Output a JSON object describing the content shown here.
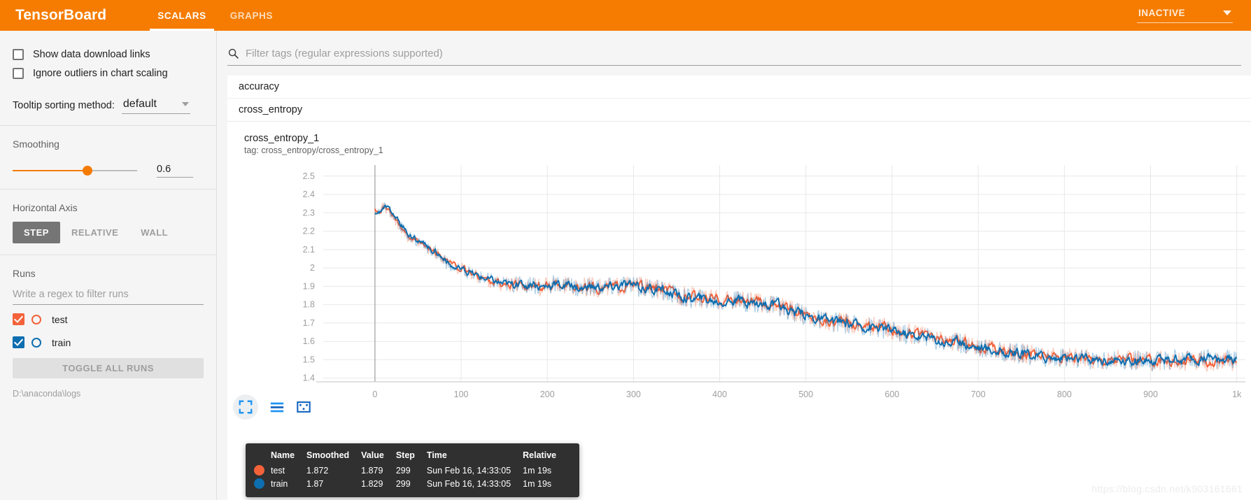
{
  "header": {
    "brand": "TensorBoard",
    "tabs": [
      {
        "label": "SCALARS",
        "active": true
      },
      {
        "label": "GRAPHS",
        "active": false
      }
    ],
    "status": "INACTIVE",
    "caret_icon": "chevron-down-icon",
    "bg_color": "#f57c00"
  },
  "sidebar": {
    "checkboxes": [
      {
        "label": "Show data download links",
        "checked": false
      },
      {
        "label": "Ignore outliers in chart scaling",
        "checked": false
      }
    ],
    "tooltip_sort": {
      "label": "Tooltip sorting method:",
      "value": "default"
    },
    "smoothing": {
      "title": "Smoothing",
      "value": "0.6",
      "fraction": 0.6
    },
    "horizontal_axis": {
      "title": "Horizontal Axis",
      "options": [
        {
          "label": "STEP",
          "active": true
        },
        {
          "label": "RELATIVE",
          "active": false
        },
        {
          "label": "WALL",
          "active": false
        }
      ]
    },
    "runs": {
      "title": "Runs",
      "filter_placeholder": "Write a regex to filter runs",
      "items": [
        {
          "name": "test",
          "checked": true,
          "color": "#f4623a"
        },
        {
          "name": "train",
          "checked": true,
          "color": "#0d6eb0"
        }
      ],
      "toggle_all_label": "TOGGLE ALL RUNS",
      "logdir": "D:\\anaconda\\logs"
    }
  },
  "main": {
    "filter": {
      "placeholder": "Filter tags (regular expressions supported)",
      "value": "",
      "icon": "search-icon"
    },
    "tags": [
      {
        "label": "accuracy",
        "expanded": false
      },
      {
        "label": "cross_entropy",
        "expanded": true
      }
    ],
    "chart": {
      "title": "cross_entropy_1",
      "tag": "tag: cross_entropy/cross_entropy_1",
      "icons": [
        "fullscreen-icon",
        "axis-scale-icon",
        "fit-domain-icon"
      ]
    },
    "tooltip": {
      "columns": [
        "Name",
        "Smoothed",
        "Value",
        "Step",
        "Time",
        "Relative"
      ],
      "rows": [
        {
          "color": "#f4623a",
          "name": "test",
          "smoothed": "1.872",
          "value": "1.879",
          "step": "299",
          "time": "Sun Feb 16, 14:33:05",
          "relative": "1m 19s"
        },
        {
          "color": "#0d6eb0",
          "name": "train",
          "smoothed": "1.87",
          "value": "1.829",
          "step": "299",
          "time": "Sun Feb 16, 14:33:05",
          "relative": "1m 19s"
        }
      ]
    },
    "watermark": "https://blog.csdn.net/k903161661"
  },
  "chart_data": {
    "type": "line",
    "title": "cross_entropy_1",
    "xlabel": "",
    "ylabel": "",
    "xlim": [
      -60,
      1010
    ],
    "ylim": [
      1.38,
      2.56
    ],
    "grid": true,
    "legend": "tooltip",
    "xticks": [
      0,
      100,
      200,
      300,
      400,
      500,
      600,
      700,
      800,
      900,
      1000
    ],
    "xticklabels": [
      "0",
      "100",
      "200",
      "300",
      "400",
      "500",
      "600",
      "700",
      "800",
      "900",
      "1k"
    ],
    "yticks": [
      1.4,
      1.5,
      1.6,
      1.7,
      1.8,
      1.9,
      2.0,
      2.1,
      2.2,
      2.3,
      2.4,
      2.5
    ],
    "yticklabels": [
      "1.4",
      "1.5",
      "1.6",
      "1.7",
      "1.8",
      "1.9",
      "2",
      "2.1",
      "2.2",
      "2.3",
      "2.4",
      "2.5"
    ],
    "smoothing": 0.6,
    "x": [
      0,
      10,
      20,
      30,
      40,
      50,
      60,
      70,
      80,
      90,
      100,
      110,
      120,
      130,
      140,
      150,
      160,
      170,
      180,
      190,
      200,
      210,
      220,
      230,
      240,
      250,
      260,
      270,
      280,
      290,
      300,
      310,
      320,
      330,
      340,
      350,
      360,
      370,
      380,
      390,
      400,
      410,
      420,
      430,
      440,
      450,
      460,
      470,
      480,
      490,
      500,
      510,
      520,
      530,
      540,
      550,
      560,
      570,
      580,
      590,
      600,
      610,
      620,
      630,
      640,
      650,
      660,
      670,
      680,
      690,
      700,
      710,
      720,
      730,
      740,
      750,
      760,
      770,
      780,
      790,
      800,
      810,
      820,
      830,
      840,
      850,
      860,
      870,
      880,
      890,
      900,
      910,
      920,
      930,
      940,
      950,
      960,
      970,
      980,
      990,
      1000
    ],
    "series": [
      {
        "name": "test",
        "color": "#f4623a",
        "values": [
          2.3,
          2.33,
          2.28,
          2.22,
          2.16,
          2.13,
          2.1,
          2.08,
          2.05,
          2.01,
          1.99,
          1.97,
          1.95,
          1.93,
          1.92,
          1.91,
          1.905,
          1.91,
          1.9,
          1.895,
          1.9,
          1.91,
          1.905,
          1.9,
          1.895,
          1.9,
          1.895,
          1.89,
          1.9,
          1.905,
          1.9,
          1.895,
          1.89,
          1.885,
          1.87,
          1.855,
          1.845,
          1.84,
          1.835,
          1.83,
          1.825,
          1.83,
          1.825,
          1.82,
          1.815,
          1.81,
          1.8,
          1.79,
          1.775,
          1.76,
          1.745,
          1.73,
          1.72,
          1.71,
          1.705,
          1.7,
          1.695,
          1.69,
          1.685,
          1.675,
          1.665,
          1.655,
          1.645,
          1.635,
          1.625,
          1.615,
          1.605,
          1.6,
          1.595,
          1.585,
          1.575,
          1.565,
          1.555,
          1.545,
          1.54,
          1.535,
          1.53,
          1.525,
          1.52,
          1.515,
          1.515,
          1.51,
          1.51,
          1.505,
          1.505,
          1.505,
          1.5,
          1.5,
          1.5,
          1.5,
          1.495,
          1.495,
          1.495,
          1.49,
          1.49,
          1.49,
          1.49,
          1.49,
          1.49,
          1.49,
          1.49
        ]
      },
      {
        "name": "train",
        "color": "#0d6eb0",
        "values": [
          2.29,
          2.34,
          2.29,
          2.23,
          2.17,
          2.14,
          2.11,
          2.09,
          2.04,
          2.0,
          1.985,
          1.97,
          1.955,
          1.94,
          1.925,
          1.915,
          1.91,
          1.915,
          1.905,
          1.9,
          1.905,
          1.915,
          1.9,
          1.895,
          1.89,
          1.895,
          1.9,
          1.895,
          1.905,
          1.91,
          1.895,
          1.89,
          1.885,
          1.88,
          1.865,
          1.85,
          1.84,
          1.835,
          1.83,
          1.825,
          1.82,
          1.825,
          1.82,
          1.815,
          1.81,
          1.805,
          1.795,
          1.785,
          1.77,
          1.755,
          1.74,
          1.725,
          1.715,
          1.705,
          1.7,
          1.695,
          1.69,
          1.685,
          1.68,
          1.67,
          1.66,
          1.65,
          1.64,
          1.63,
          1.62,
          1.61,
          1.6,
          1.595,
          1.59,
          1.58,
          1.57,
          1.56,
          1.55,
          1.54,
          1.535,
          1.53,
          1.525,
          1.52,
          1.515,
          1.51,
          1.51,
          1.505,
          1.505,
          1.5,
          1.5,
          1.5,
          1.495,
          1.495,
          1.495,
          1.495,
          1.49,
          1.495,
          1.5,
          1.5,
          1.5,
          1.5,
          1.5,
          1.5,
          1.5,
          1.505,
          1.505
        ]
      }
    ]
  }
}
